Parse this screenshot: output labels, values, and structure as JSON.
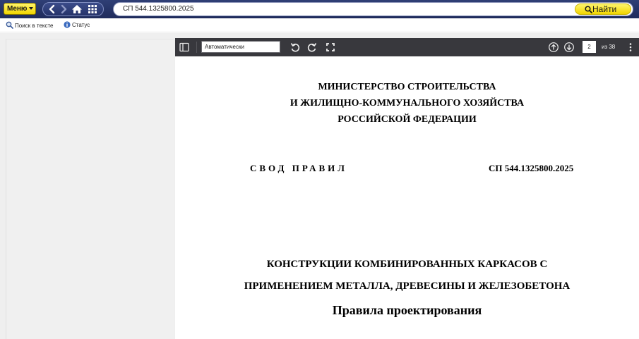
{
  "topbar": {
    "menu_label": "Меню",
    "search_value": "СП 544.1325800.2025",
    "find_label": "Найти"
  },
  "subbar": {
    "search_in_text": "Поиск в тексте",
    "status": "Статус"
  },
  "pdf_toolbar": {
    "zoom_value": "Автоматически",
    "page_number": "2",
    "page_total": "из 38"
  },
  "document": {
    "ministry_lines": [
      "МИНИСТЕРСТВО СТРОИТЕЛЬСТВА",
      "И ЖИЛИЩНО-КОММУНАЛЬНОГО ХОЗЯЙСТВА",
      "РОССИЙСКОЙ ФЕДЕРАЦИИ"
    ],
    "svod_label": "СВОД ПРАВИЛ",
    "code": "СП 544.1325800.2025",
    "title_line1": "КОНСТРУКЦИИ КОМБИНИРОВАННЫХ КАРКАСОВ С",
    "title_line2": "ПРИМЕНЕНИЕМ МЕТАЛЛА, ДРЕВЕСИНЫ И ЖЕЛЕЗОБЕТОНА",
    "subtitle": "Правила проектирования"
  },
  "colors": {
    "topbar": "#1f2b5c",
    "accent_yellow": "#f2d500",
    "pdf_toolbar": "#38383d"
  }
}
